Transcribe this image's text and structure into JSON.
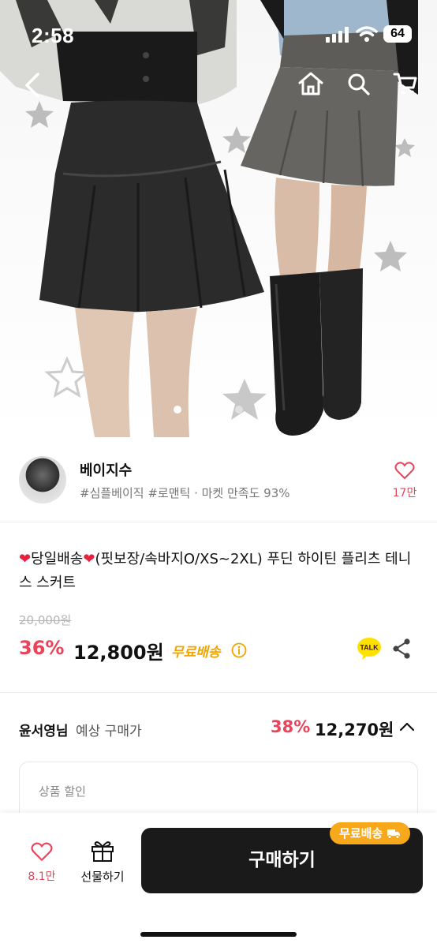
{
  "status_bar": {
    "time": "2:58",
    "battery": "64"
  },
  "hero": {
    "image_count": 2,
    "current_index": 1
  },
  "seller": {
    "name": "베이지수",
    "tags": "#심플베이직 #로맨틱 · 마켓 만족도 93%",
    "like_count": "17만"
  },
  "product": {
    "title_part1": "당일배송",
    "title_part2": "(핏보장/속바지O/XS~2XL) 푸딘 하이틴 플리츠 테니스 스커트",
    "original_price": "20,000원",
    "discount": "36%",
    "price": "12,800원",
    "free_shipping": "무료배송",
    "talk_label": "TALK"
  },
  "expected_price": {
    "user": "윤서영님",
    "label": "예상 구매가",
    "discount": "38%",
    "price": "12,270원"
  },
  "discount_card": {
    "label": "상품 할인"
  },
  "bottom_bar": {
    "like_count": "8.1만",
    "gift_label": "선물하기",
    "buy_label": "구매하기",
    "ship_badge": "무료배송"
  },
  "colors": {
    "accent_pink": "#e8445a",
    "free_ship": "#f0a500",
    "buy_button": "#1a1a1a",
    "talk_yellow": "#ffe100"
  }
}
